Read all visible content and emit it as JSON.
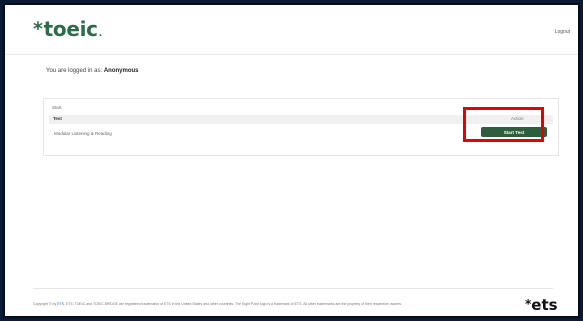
{
  "header": {
    "logo_star": "*",
    "logo_text": "toeic",
    "logo_dot": ".",
    "logout_label": "Logout"
  },
  "status": {
    "logged_in_prefix": "You are logged in as:",
    "username": "Anonymous"
  },
  "panel": {
    "title": "Start",
    "columns": [
      "Test",
      "Action"
    ],
    "rows": [
      {
        "test": "Modular Listening & Reading",
        "action_label": "Start Test"
      }
    ]
  },
  "footer": {
    "copyright_prefix": "Copyright © by",
    "copyright_link": "ETS",
    "copyright_rest": ". ETS, TOEIC and TOEIC BRIDGE are registered trademarks of ETS in the United States and other countries. The Eight Point logo is a trademark of ETS. All other trademarks are the property of their respective owners.",
    "ets_star": "*",
    "ets_text": "ets"
  },
  "colors": {
    "brand_green": "#2f6b4a",
    "button_green": "#2e5e3e",
    "highlight_red": "#e60000"
  },
  "icons": {
    "logo": "toeic-asterisk-logo",
    "footer_logo": "ets-asterisk-logo"
  }
}
